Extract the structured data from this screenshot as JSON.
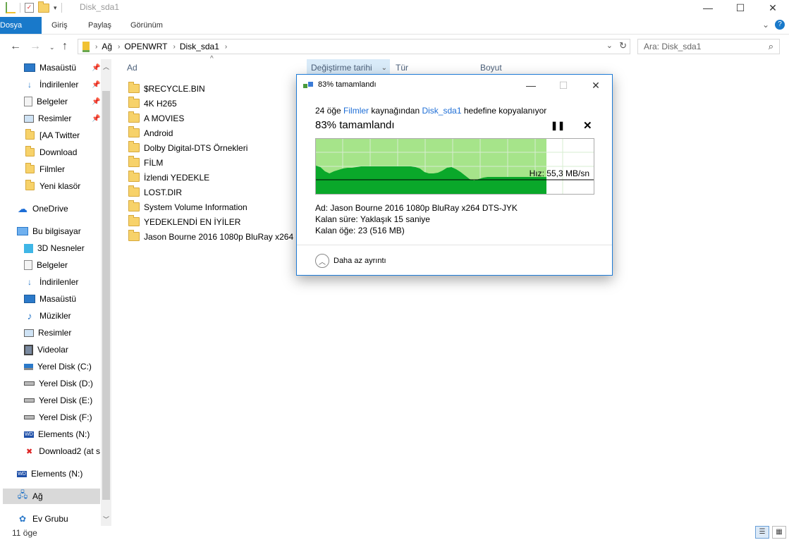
{
  "window": {
    "title": "Disk_sda1"
  },
  "ribbon": {
    "file": "Dosya",
    "tabs": [
      "Giriş",
      "Paylaş",
      "Görünüm"
    ]
  },
  "address": {
    "crumbs": [
      "Ağ",
      "OPENWRT",
      "Disk_sda1"
    ]
  },
  "search": {
    "placeholder": "Ara: Disk_sda1"
  },
  "nav": {
    "quick": [
      {
        "label": "Masaüstü",
        "icon": "desktop-icon",
        "pinned": true
      },
      {
        "label": "İndirilenler",
        "icon": "download-icon",
        "pinned": true
      },
      {
        "label": "Belgeler",
        "icon": "documents-icon",
        "pinned": true
      },
      {
        "label": "Resimler",
        "icon": "pictures-icon",
        "pinned": true
      },
      {
        "label": "[AA Twitter",
        "icon": "folder-icon",
        "pinned": false
      },
      {
        "label": "Download",
        "icon": "folder-icon",
        "pinned": false
      },
      {
        "label": "Filmler",
        "icon": "folder-icon",
        "pinned": false
      },
      {
        "label": "Yeni klasör",
        "icon": "folder-icon",
        "pinned": false
      }
    ],
    "onedrive": "OneDrive",
    "thispc": "Bu bilgisayar",
    "pc_items": [
      {
        "label": "3D Nesneler",
        "icon": "3d-objects-icon"
      },
      {
        "label": "Belgeler",
        "icon": "documents-icon"
      },
      {
        "label": "İndirilenler",
        "icon": "download-icon"
      },
      {
        "label": "Masaüstü",
        "icon": "desktop-icon"
      },
      {
        "label": "Müzikler",
        "icon": "music-icon"
      },
      {
        "label": "Resimler",
        "icon": "pictures-icon"
      },
      {
        "label": "Videolar",
        "icon": "videos-icon"
      },
      {
        "label": "Yerel Disk (C:)",
        "icon": "windows-drive-icon"
      },
      {
        "label": "Yerel Disk (D:)",
        "icon": "drive-icon"
      },
      {
        "label": "Yerel Disk (E:)",
        "icon": "drive-icon"
      },
      {
        "label": "Yerel Disk (F:)",
        "icon": "drive-icon"
      },
      {
        "label": "Elements (N:)",
        "icon": "wd-drive-icon"
      },
      {
        "label": "Download2 (at s",
        "icon": "disconnected-drive-icon"
      }
    ],
    "elements": "Elements (N:)",
    "network": "Ağ",
    "homegroup": "Ev Grubu"
  },
  "columns": {
    "name": "Ad",
    "date": "Değiştirme tarihi",
    "type": "Tür",
    "size": "Boyut"
  },
  "files": [
    "$RECYCLE.BIN",
    "4K H265",
    "A MOVIES",
    "Android",
    "Dolby Digital-DTS Örnekleri",
    "FİLM",
    "İzlendi YEDEKLE",
    "LOST.DIR",
    "System Volume Information",
    "YEDEKLENDİ EN İYİLER",
    "Jason Bourne 2016 1080p BluRay x264 DT..."
  ],
  "status": {
    "count": "11 öge"
  },
  "dialog": {
    "title": "83%  tamamlandı",
    "line_count": "24 öğe",
    "line_src": "Filmler",
    "line_mid": "kaynağından",
    "line_dst": "Disk_sda1",
    "line_end": "hedefine kopyalanıyor",
    "headline": "83%  tamamlandı",
    "progress": 0.83,
    "speed": "Hız: 55,3 MB/sn",
    "name": "Ad:  Jason Bourne 2016 1080p BluRay x264 DTS-JYK",
    "remaining_time": "Kalan süre:  Yaklaşık 15 saniye",
    "remaining_items": "Kalan öğe:  23 (516 MB)",
    "less_details": "Daha az ayrıntı",
    "colors": {
      "fill_dark": "#0aa82a",
      "fill_light": "#a6e48a"
    }
  }
}
